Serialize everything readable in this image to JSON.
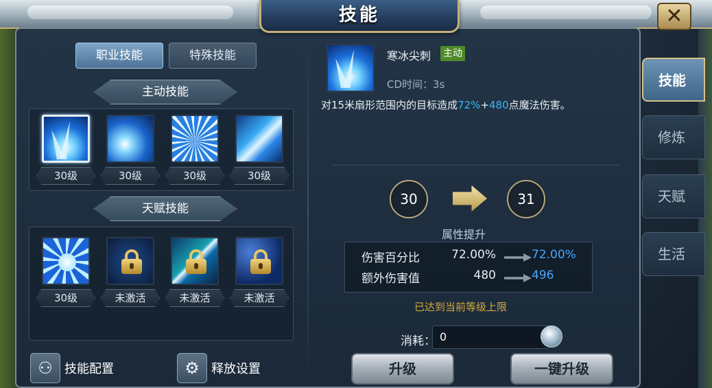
{
  "header": {
    "title": "技能",
    "close_label": "✕"
  },
  "left": {
    "tabs": [
      {
        "label": "职业技能",
        "active": true
      },
      {
        "label": "特殊技能",
        "active": false
      }
    ],
    "active_section": {
      "title": "主动技能",
      "skills": [
        {
          "icon": "ice-spike-icon",
          "level": "30级",
          "selected": true
        },
        {
          "icon": "ice-comet-icon",
          "level": "30级"
        },
        {
          "icon": "frost-burst-icon",
          "level": "30级"
        },
        {
          "icon": "ice-shard-icon",
          "level": "30级"
        }
      ]
    },
    "talent_section": {
      "title": "天赋技能",
      "skills": [
        {
          "icon": "frost-vortex-icon",
          "level": "30级"
        },
        {
          "icon": "locked-icon",
          "level": "未激活"
        },
        {
          "icon": "locked-icon",
          "level": "未激活"
        },
        {
          "icon": "locked-icon",
          "level": "未激活"
        }
      ]
    },
    "bottom": {
      "config_label": "技能配置",
      "release_label": "释放设置"
    }
  },
  "detail": {
    "name": "寒冰尖刺",
    "badge": "主动",
    "cd": "CD时间：3s",
    "desc_prefix": "对15米扇形范围内的目标造成",
    "desc_pct": "72%",
    "desc_plus": "+",
    "desc_flat": "480",
    "desc_suffix": "点魔法伤害。",
    "level_from": "30",
    "level_to": "31",
    "attr_title": "属性提升",
    "stats": [
      {
        "label": "伤害百分比",
        "current": "72.00%",
        "next": "72.00%"
      },
      {
        "label": "额外伤害值",
        "current": "480",
        "next": "496"
      }
    ],
    "max_note": "已达到当前等级上限",
    "cost_label": "消耗：",
    "cost_value": "0",
    "upgrade_label": "升级",
    "upgrade_all_label": "一键升级"
  },
  "side_tabs": [
    {
      "label": "技能",
      "active": true
    },
    {
      "label": "修炼"
    },
    {
      "label": "天赋"
    },
    {
      "label": "生活"
    }
  ],
  "colors": {
    "accent": "#39b8ff",
    "gold": "#d4a93a",
    "badge": "#4f8a2a"
  }
}
